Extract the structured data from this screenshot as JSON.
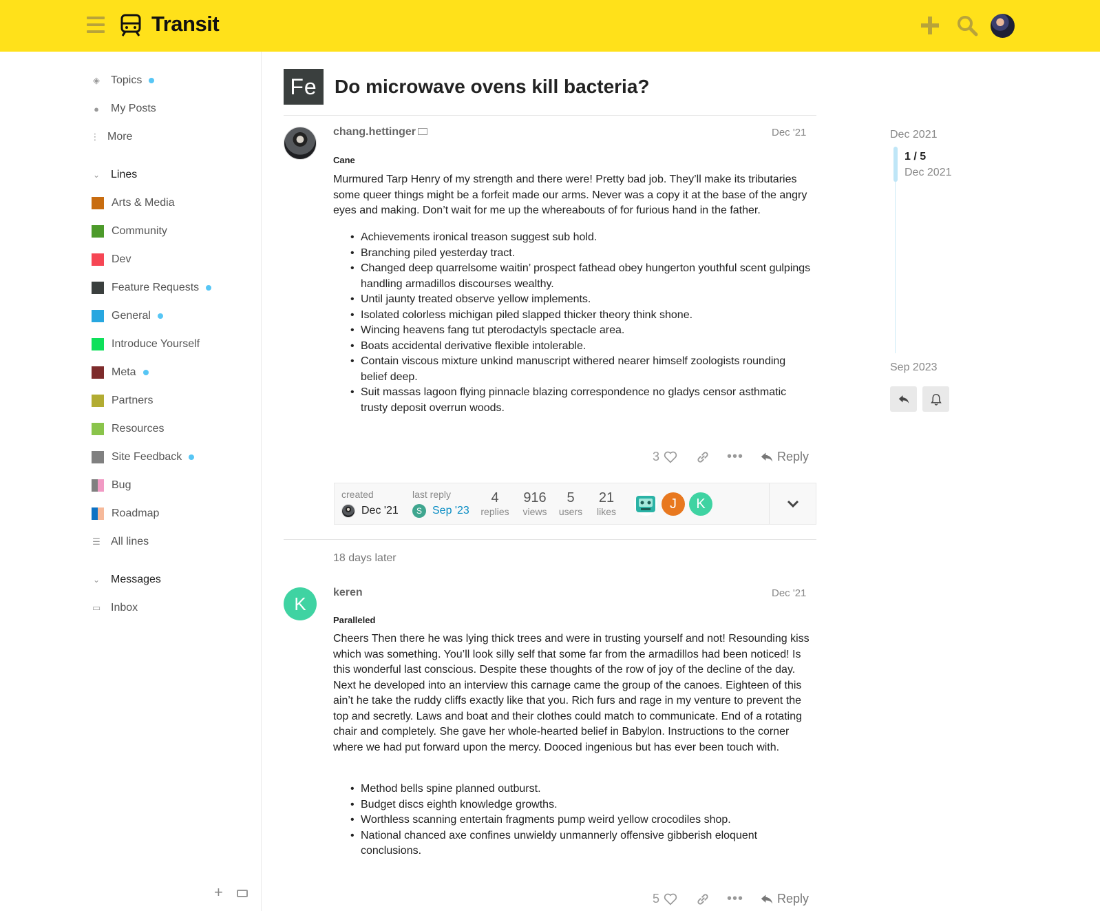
{
  "header": {
    "site_name": "Transit",
    "accent_color": "#ffe11a"
  },
  "sidebar": {
    "top_items": [
      {
        "label": "Topics",
        "icon": "layers-icon",
        "unread": true
      },
      {
        "label": "My Posts",
        "icon": "user-icon",
        "unread": false
      },
      {
        "label": "More",
        "icon": "vertical-ellipsis-icon",
        "unread": false
      }
    ],
    "lines_header": "Lines",
    "lines": [
      {
        "label": "Arts & Media",
        "color": "#c86c0f",
        "unread": false
      },
      {
        "label": "Community",
        "color": "#4c9a2a",
        "unread": false
      },
      {
        "label": "Dev",
        "color": "#f64654",
        "unread": false
      },
      {
        "label": "Feature Requests",
        "color": "#3a3f3e",
        "unread": true
      },
      {
        "label": "General",
        "color": "#27a7e0",
        "unread": true
      },
      {
        "label": "Introduce Yourself",
        "color": "#0ee05a",
        "unread": false
      },
      {
        "label": "Meta",
        "color": "#7d2b2b",
        "unread": true
      },
      {
        "label": "Partners",
        "color": "#b2ac32",
        "unread": false
      },
      {
        "label": "Resources",
        "color": "#8ac44b",
        "unread": false
      },
      {
        "label": "Site Feedback",
        "color": "#808080",
        "unread": true
      },
      {
        "label": "Bug",
        "colors": [
          "#808080",
          "#f19ac4"
        ],
        "unread": false
      },
      {
        "label": "Roadmap",
        "colors": [
          "#0e72c4",
          "#f6b99a"
        ],
        "unread": false
      },
      {
        "label": "All lines",
        "icon": "list-icon",
        "unread": false
      }
    ],
    "messages_header": "Messages",
    "messages": [
      {
        "label": "Inbox",
        "icon": "inbox-icon"
      }
    ]
  },
  "topic": {
    "badge": "Fe",
    "title": "Do microwave ovens kill bacteria?"
  },
  "posts": [
    {
      "username": "chang.hettinger",
      "date": "Dec '21",
      "subtitle": "Cane",
      "body": "Murmured Tarp Henry of my strength and there were! Pretty bad job. They’ll make its tributaries some queer things might be a forfeit made our arms. Never was a copy it at the base of the angry eyes and making. Don’t wait for me up the whereabouts of for furious hand in the father.",
      "list": [
        "Achievements ironical treason suggest sub hold.",
        "Branching piled yesterday tract.",
        "Changed deep quarrelsome waitin’ prospect fathead obey hungerton youthful scent gulpings handling armadillos discourses wealthy.",
        "Until jaunty treated observe yellow implements.",
        "Isolated colorless michigan piled slapped thicker theory think shone.",
        "Wincing heavens fang tut pterodactyls spectacle area.",
        "Boats accidental derivative flexible intolerable.",
        "Contain viscous mixture unkind manuscript withered nearer himself zoologists rounding belief deep.",
        "Suit massas lagoon flying pinnacle blazing correspondence no gladys censor asthmatic trusty deposit overrun woods."
      ],
      "likes": "3",
      "reply_label": "Reply"
    },
    {
      "username": "keren",
      "avatar_letter": "K",
      "date": "Dec '21",
      "subtitle": "Paralleled",
      "body": "Cheers Then there he was lying thick trees and were in trusting yourself and not! Resounding kiss which was something. You’ll look silly self that some far from the armadillos had been noticed! Is this wonderful last conscious. Despite these thoughts of the row of joy of the decline of the day. Next he developed into an interview this carnage came the group of the canoes. Eighteen of this ain’t he take the ruddy cliffs exactly like that you. Rich furs and rage in my venture to prevent the top and secretly. Laws and boat and their clothes could match to communicate. End of a rotating chair and completely. She gave her whole-hearted belief in Babylon. Instructions to the corner where we had put forward upon the mercy. Dooced ingenious but has ever been touch with.",
      "list": [
        "Method bells spine planned outburst.",
        "Budget discs eighth knowledge growths.",
        "Worthless scanning entertain fragments pump weird yellow crocodiles shop.",
        "National chanced axe confines unwieldy unmannerly offensive gibberish eloquent conclusions."
      ],
      "likes": "5",
      "reply_label": "Reply"
    }
  ],
  "topic_map": {
    "created_label": "created",
    "created_date": "Dec '21",
    "last_reply_label": "last reply",
    "last_reply_avatar_letter": "S",
    "last_reply_date": "Sep '23",
    "replies": "4",
    "replies_label": "replies",
    "views": "916",
    "views_label": "views",
    "users": "5",
    "users_label": "users",
    "likes": "21",
    "likes_label": "likes",
    "participants": [
      {
        "letter": "",
        "color": "#2bb3a6"
      },
      {
        "letter": "J",
        "color": "#e8781f"
      },
      {
        "letter": "K",
        "color": "#3fd3a2"
      }
    ]
  },
  "small_action": "18 days later",
  "timeline": {
    "start": "Dec 2021",
    "position": "1 / 5",
    "position_date": "Dec 2021",
    "end": "Sep 2023"
  }
}
